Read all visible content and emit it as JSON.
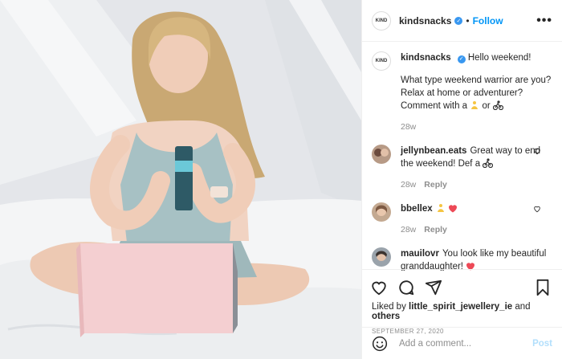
{
  "colors": {
    "accent": "#0095f6",
    "verified": "#3897f0",
    "muted": "#8e8e8e",
    "heart_red": "#ed4956"
  },
  "header": {
    "username": "kindsnacks",
    "logo_text": "KIND",
    "separator": "•",
    "follow_label": "Follow",
    "more_label": "•••"
  },
  "caption": {
    "username": "kindsnacks",
    "greeting": "Hello weekend!",
    "line1": "What type weekend warrior are you?",
    "line2": "Relax at home or adventurer?",
    "line3_prefix": "Comment with a",
    "line3_middle": "or",
    "time": "28w"
  },
  "comments": [
    {
      "username": "jellynbean.eats",
      "text": "Great way to end the weekend! Def a",
      "time": "28w",
      "reply_label": "Reply"
    },
    {
      "username": "bbellex",
      "text": "",
      "time": "28w",
      "reply_label": "Reply"
    },
    {
      "username": "mauilovr",
      "text": "You look like my beautiful granddaughter!",
      "time": "",
      "reply_label": ""
    }
  ],
  "icons": {
    "like": "heart-icon",
    "comment": "comment-icon",
    "share": "share-icon",
    "save": "bookmark-icon",
    "emoji": "emoji-icon"
  },
  "likes": {
    "prefix": "Liked by",
    "user": "little_spirit_jewellery_ie",
    "and": "and",
    "others": "others"
  },
  "date": "SEPTEMBER 27, 2020",
  "add_comment": {
    "placeholder": "Add a comment...",
    "post_label": "Post"
  }
}
